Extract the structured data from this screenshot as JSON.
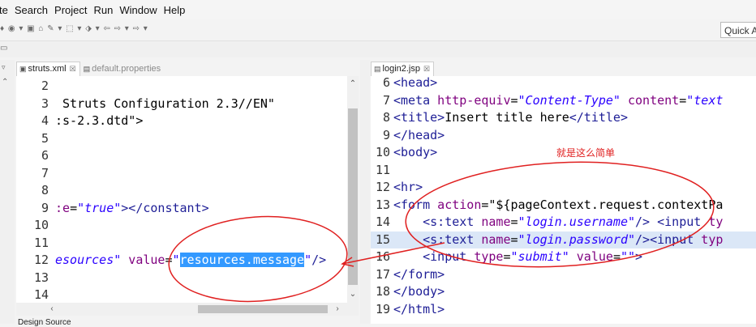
{
  "menubar": {
    "items": [
      "te",
      "Search",
      "Project",
      "Run",
      "Window",
      "Help"
    ]
  },
  "toolbar": {
    "icons_text": "♦ ◉ ▾ ▣ ⌂ ✎ ▾ ⬚ ▾ ⬗ ▾ ⇦ ⇨ ▾ ⇨ ▾",
    "quick_access": "Quick A"
  },
  "left_editor": {
    "tabs": [
      {
        "icon": "xml-file-icon",
        "label": "struts.xml",
        "close": "☒",
        "active": true
      },
      {
        "icon": "properties-file-icon",
        "label": "default.properties",
        "active": false
      }
    ],
    "lines": [
      {
        "num": "2",
        "parts": []
      },
      {
        "num": "3",
        "parts": [
          {
            "c": "t",
            "t": " Struts Configuration 2.3//EN\""
          }
        ]
      },
      {
        "num": "4",
        "parts": [
          {
            "c": "t",
            "t": ":s-2.3.dtd\">"
          }
        ]
      },
      {
        "num": "5",
        "parts": []
      },
      {
        "num": "6",
        "parts": []
      },
      {
        "num": "7",
        "parts": []
      },
      {
        "num": "8",
        "parts": []
      },
      {
        "num": "9",
        "parts": [
          {
            "c": "attr",
            "t": ":e"
          },
          {
            "c": "t",
            "t": "="
          },
          {
            "c": "str",
            "t": "\"true\""
          },
          {
            "c": "tag",
            "t": "></constant>"
          }
        ]
      },
      {
        "num": "10",
        "parts": []
      },
      {
        "num": "11",
        "parts": []
      },
      {
        "num": "12",
        "parts": [
          {
            "c": "str",
            "t": "esources\""
          },
          {
            "c": "attr",
            "t": " value"
          },
          {
            "c": "t",
            "t": "="
          },
          {
            "c": "str",
            "t": "\""
          },
          {
            "c": "sel",
            "t": "resources.message"
          },
          {
            "c": "str",
            "t": "\""
          },
          {
            "c": "tag",
            "t": "/>"
          }
        ]
      },
      {
        "num": "13",
        "parts": []
      },
      {
        "num": "14",
        "parts": []
      }
    ],
    "bottom_tabs": "Design Source"
  },
  "right_editor": {
    "tabs": [
      {
        "icon": "jsp-file-icon",
        "label": "login2.jsp",
        "close": "☒",
        "active": true
      }
    ],
    "lines": [
      {
        "num": "6",
        "parts": [
          {
            "c": "tag",
            "t": "<head>"
          }
        ]
      },
      {
        "num": "7",
        "parts": [
          {
            "c": "tag",
            "t": "<meta"
          },
          {
            "c": "attr",
            "t": " http-equiv"
          },
          {
            "c": "t",
            "t": "="
          },
          {
            "c": "str",
            "t": "\"Content-Type\""
          },
          {
            "c": "attr",
            "t": " content"
          },
          {
            "c": "t",
            "t": "="
          },
          {
            "c": "str",
            "t": "\"text"
          }
        ]
      },
      {
        "num": "8",
        "parts": [
          {
            "c": "tag",
            "t": "<title>"
          },
          {
            "c": "t",
            "t": "Insert title here"
          },
          {
            "c": "tag",
            "t": "</title>"
          }
        ]
      },
      {
        "num": "9",
        "parts": [
          {
            "c": "tag",
            "t": "</head>"
          }
        ]
      },
      {
        "num": "10",
        "parts": [
          {
            "c": "tag",
            "t": "<body>"
          }
        ]
      },
      {
        "num": "11",
        "parts": []
      },
      {
        "num": "12",
        "parts": [
          {
            "c": "tag",
            "t": "<hr>"
          }
        ]
      },
      {
        "num": "13",
        "parts": [
          {
            "c": "tag",
            "t": "<form"
          },
          {
            "c": "attr",
            "t": " action"
          },
          {
            "c": "t",
            "t": "=\"${pageContext.request.contextPa"
          }
        ]
      },
      {
        "num": "14",
        "parts": [
          {
            "c": "t",
            "t": "    "
          },
          {
            "c": "tag",
            "t": "<s:text"
          },
          {
            "c": "attr",
            "t": " name"
          },
          {
            "c": "t",
            "t": "="
          },
          {
            "c": "str",
            "t": "\"login.username\""
          },
          {
            "c": "tag",
            "t": "/> <input"
          },
          {
            "c": "attr",
            "t": " ty"
          }
        ]
      },
      {
        "num": "15",
        "parts": [
          {
            "c": "t",
            "t": "    "
          },
          {
            "c": "tag",
            "t": "<s:text"
          },
          {
            "c": "attr",
            "t": " name"
          },
          {
            "c": "t",
            "t": "="
          },
          {
            "c": "str",
            "t": "\"login.password\""
          },
          {
            "c": "tag",
            "t": "/><input"
          },
          {
            "c": "attr",
            "t": " typ"
          }
        ]
      },
      {
        "num": "16",
        "parts": [
          {
            "c": "t",
            "t": "    "
          },
          {
            "c": "tag",
            "t": "<input"
          },
          {
            "c": "attr",
            "t": " type"
          },
          {
            "c": "t",
            "t": "="
          },
          {
            "c": "str",
            "t": "\"submit\""
          },
          {
            "c": "attr",
            "t": " value"
          },
          {
            "c": "t",
            "t": "="
          },
          {
            "c": "str",
            "t": "\"\""
          },
          {
            "c": "tag",
            "t": ">"
          }
        ]
      },
      {
        "num": "17",
        "parts": [
          {
            "c": "tag",
            "t": "</form>"
          }
        ]
      },
      {
        "num": "18",
        "parts": [
          {
            "c": "tag",
            "t": "</body>"
          }
        ]
      },
      {
        "num": "19",
        "parts": [
          {
            "c": "tag",
            "t": "</html>"
          }
        ]
      }
    ]
  },
  "annotation": {
    "text": "就是这么简单",
    "color": "#e02020"
  },
  "colors": {
    "tag": "#1e1e96",
    "attr": "#7f007f",
    "string": "#2a00ff",
    "selection": "#3399ff"
  }
}
